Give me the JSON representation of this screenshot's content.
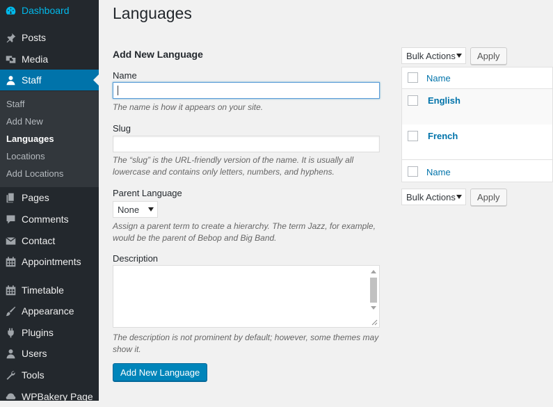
{
  "sidebar": {
    "items": [
      {
        "label": "Dashboard",
        "icon": "dashboard-icon"
      },
      {
        "label": "Posts",
        "icon": "pin-icon"
      },
      {
        "label": "Media",
        "icon": "media-icon"
      },
      {
        "label": "Staff",
        "icon": "user-icon"
      },
      {
        "label": "Pages",
        "icon": "pages-icon"
      },
      {
        "label": "Comments",
        "icon": "comment-icon"
      },
      {
        "label": "Contact",
        "icon": "mail-icon"
      },
      {
        "label": "Appointments",
        "icon": "calendar-icon"
      },
      {
        "label": "Timetable",
        "icon": "calendar-icon"
      },
      {
        "label": "Appearance",
        "icon": "brush-icon"
      },
      {
        "label": "Plugins",
        "icon": "plugin-icon"
      },
      {
        "label": "Users",
        "icon": "users-icon"
      },
      {
        "label": "Tools",
        "icon": "wrench-icon"
      },
      {
        "label": "WPBakery Page",
        "icon": "bakery-icon"
      }
    ],
    "submenu": [
      "Staff",
      "Add New",
      "Languages",
      "Locations",
      "Add Locations"
    ],
    "active_item": "Staff",
    "current_submenu": "Languages"
  },
  "page": {
    "title": "Languages"
  },
  "form": {
    "section_title": "Add New Language",
    "name_label": "Name",
    "name_value": "",
    "name_desc": "The name is how it appears on your site.",
    "slug_label": "Slug",
    "slug_value": "",
    "slug_desc": "The “slug” is the URL-friendly version of the name. It is usually all lowercase and contains only letters, numbers, and hyphens.",
    "parent_label": "Parent Language",
    "parent_value": "None",
    "parent_desc": "Assign a parent term to create a hierarchy. The term Jazz, for example, would be the parent of Bebop and Big Band.",
    "description_label": "Description",
    "description_value": "",
    "description_desc": "The description is not prominent by default; however, some themes may show it.",
    "submit_label": "Add New Language"
  },
  "list": {
    "bulk_actions_label": "Bulk Actions",
    "apply_label": "Apply",
    "column_name": "Name",
    "rows": [
      "English",
      "French"
    ]
  },
  "colors": {
    "sidebar_bg": "#23282d",
    "accent": "#0073aa",
    "primary_button": "#0085ba"
  }
}
